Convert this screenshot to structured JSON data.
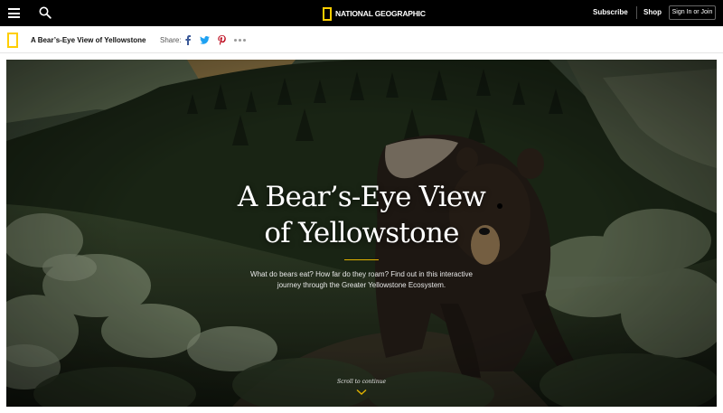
{
  "topbar": {
    "brand": "NATIONAL GEOGRAPHIC",
    "subscribe": "Subscribe",
    "shop": "Shop",
    "signin": "Sign In or Join",
    "icons": {
      "menu": "hamburger-menu-icon",
      "search": "search-icon"
    }
  },
  "subbar": {
    "article_title": "A Bear’s-Eye View of Yellowstone",
    "share_label": "Share:",
    "share_icons": [
      "facebook-icon",
      "twitter-icon",
      "pinterest-icon",
      "more-icon"
    ]
  },
  "hero": {
    "title_line1": "A Bear’s-Eye View",
    "title_line2": "of Yellowstone",
    "dek_line1": "What do bears eat? How far do they roam? Find out in this interactive",
    "dek_line2": "journey through the Greater Yellowstone Ecosystem.",
    "scroll_label": "Scroll to continue"
  },
  "colors": {
    "brand_yellow": "#ffce00",
    "accent_rule": "#e0b100",
    "facebook": "#3b5998",
    "twitter": "#1da1f2",
    "pinterest": "#bd081c"
  }
}
